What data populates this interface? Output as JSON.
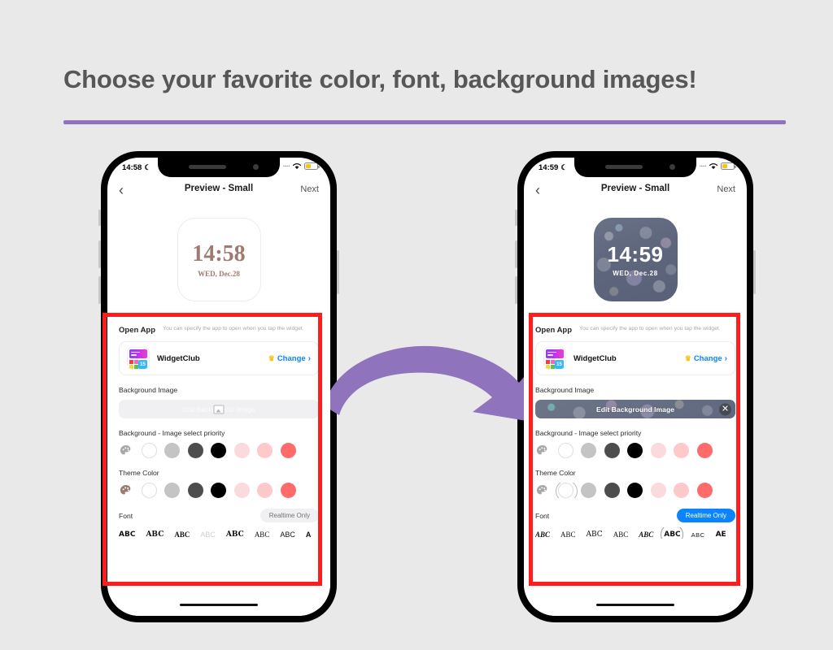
{
  "header": {
    "headline": "Choose your favorite color, font, background images!",
    "accent_color": "#9073bd",
    "text_color": "#575757"
  },
  "canvas": {
    "background": "#e9e9e9",
    "highlight_color": "#fe1d1d"
  },
  "phones": [
    {
      "id": "before",
      "status_bar": {
        "time": "14:58",
        "moon_icon": "☾",
        "dots": "·····",
        "wifi_icon": "wifi-icon",
        "battery_icon": "battery-icon"
      },
      "nav": {
        "back_icon": "‹",
        "title": "Preview - Small",
        "next_label": "Next"
      },
      "widget": {
        "style": "plain",
        "time": "14:58",
        "date": "WED, Dec.28",
        "text_color": "#9d7b72",
        "background": "#ffffff"
      },
      "open_app": {
        "label": "Open App",
        "description": "You can specify the app to open when you tap the widget.",
        "app_name": "WidgetClub",
        "app_icon_badge": "15",
        "crown_icon": "♛",
        "change_label": "Change",
        "chevron": "›"
      },
      "background_image": {
        "label": "Background Image",
        "button_label": "Edit Background Image",
        "state": "disabled",
        "has_close": false,
        "image_icon": "image-icon"
      },
      "bg_priority": {
        "label": "Background - Image select priority",
        "palette_icon": "palette-icon",
        "palette_color": "#a8a8a8",
        "swatches": [
          "#ffffff",
          "#c4c4c4",
          "#4d4d4d",
          "#000000",
          "#fadadd",
          "#ffc9c9",
          "#ff6b6b"
        ],
        "selected_index": -1
      },
      "theme_color": {
        "label": "Theme Color",
        "palette_icon": "palette-icon",
        "palette_color": "#9d7b72",
        "swatches": [
          "#ffffff",
          "#c4c4c4",
          "#4d4d4d",
          "#000000",
          "#fadadd",
          "#ffc9c9",
          "#ff6b6b"
        ],
        "selected_index": -1
      },
      "font": {
        "label": "Font",
        "realtime_pill": "Realtime Only",
        "realtime_active": false,
        "samples": [
          "ABC",
          "ABC",
          "ABC",
          "ABC",
          "ABC",
          "ABC",
          "ABC",
          "A"
        ],
        "selected_index": -1
      },
      "home_indicator": true
    },
    {
      "id": "after",
      "status_bar": {
        "time": "14:59",
        "moon_icon": "☾",
        "dots": "·····",
        "wifi_icon": "wifi-icon",
        "battery_icon": "battery-icon"
      },
      "nav": {
        "back_icon": "‹",
        "title": "Preview - Small",
        "next_label": "Next"
      },
      "widget": {
        "style": "photo",
        "time": "14:59",
        "date": "WED, Dec.28",
        "text_color": "#ffffff",
        "background": "bubble-photo"
      },
      "open_app": {
        "label": "Open App",
        "description": "You can specify the app to open when you tap the widget.",
        "app_name": "WidgetClub",
        "app_icon_badge": "15",
        "crown_icon": "♛",
        "change_label": "Change",
        "chevron": "›"
      },
      "background_image": {
        "label": "Background Image",
        "button_label": "Edit Background Image",
        "state": "active",
        "has_close": true,
        "close_icon": "✕",
        "image_icon": "image-icon"
      },
      "bg_priority": {
        "label": "Background - Image select priority",
        "palette_icon": "palette-icon",
        "palette_color": "#a8a8a8",
        "swatches": [
          "#ffffff",
          "#c4c4c4",
          "#4d4d4d",
          "#000000",
          "#fadadd",
          "#ffc9c9",
          "#ff6b6b"
        ],
        "selected_index": -1
      },
      "theme_color": {
        "label": "Theme Color",
        "palette_icon": "palette-icon",
        "palette_color": "#a8a8a8",
        "swatches": [
          "#ffffff",
          "#c4c4c4",
          "#4d4d4d",
          "#000000",
          "#fadadd",
          "#ffc9c9",
          "#ff6b6b"
        ],
        "selected_index": 0
      },
      "font": {
        "label": "Font",
        "realtime_pill": "Realtime Only",
        "realtime_active": true,
        "samples": [
          "ABC",
          "ABC",
          "ABC",
          "ABC",
          "ABC",
          "ABC",
          "ABC",
          "AE"
        ],
        "selected_index": 5
      },
      "home_indicator": true
    }
  ],
  "arrow": {
    "name": "transition-arrow",
    "color": "#9073bd",
    "direction": "right"
  }
}
